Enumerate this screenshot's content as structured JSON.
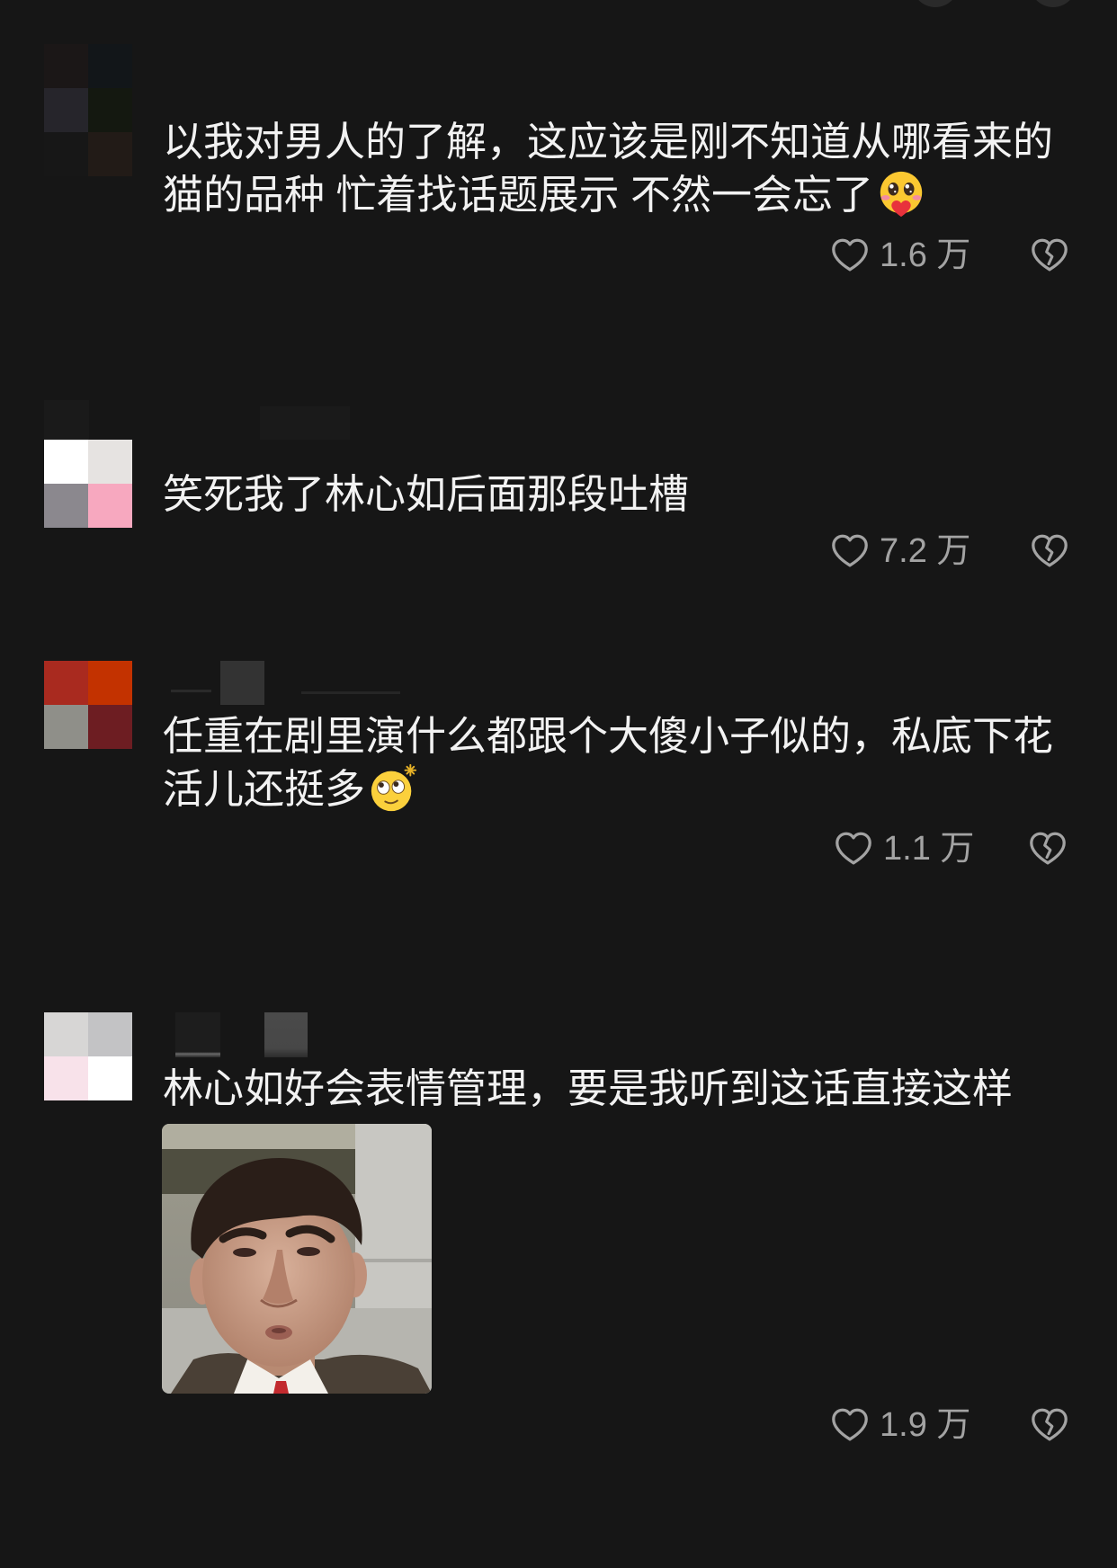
{
  "page": {
    "background": "#161616"
  },
  "colors": {
    "text": "#f2f2f2",
    "meta": "#a3a3a3"
  },
  "comments": [
    {
      "lines": [
        "以我对男人的了解，这应该是刚不知道从哪看来的",
        "猫的品种 忙着找话题展示 不然一会忘了"
      ],
      "emoji": "heart-face-emoji",
      "avatar_colors": [
        "#1b1717",
        "#121619",
        "#26252b",
        "#141810",
        "#171717",
        "#221b17"
      ],
      "likes": "1.6 万"
    },
    {
      "lines": [
        "笑死我了林心如后面那段吐槽"
      ],
      "avatar_colors": [
        "#ffffff",
        "#e6e3e1",
        "#8b888e",
        "#f7a8bf"
      ],
      "likes": "7.2 万"
    },
    {
      "lines": [
        "任重在剧里演什么都跟个大傻小子似的，私底下花",
        "活儿还挺多"
      ],
      "emoji": "dizzy-face-emoji",
      "avatar_colors": [
        "#a92a1f",
        "#c33200",
        "#8f8f89",
        "#6d1d22"
      ],
      "likes": "1.1 万"
    },
    {
      "lines": [
        "林心如好会表情管理，要是我听到这话直接这样"
      ],
      "avatar_colors": [
        "#d7d6d5",
        "#c3c3c5",
        "#f8e2ea",
        "#ffffff"
      ],
      "likes": "1.9 万"
    }
  ]
}
